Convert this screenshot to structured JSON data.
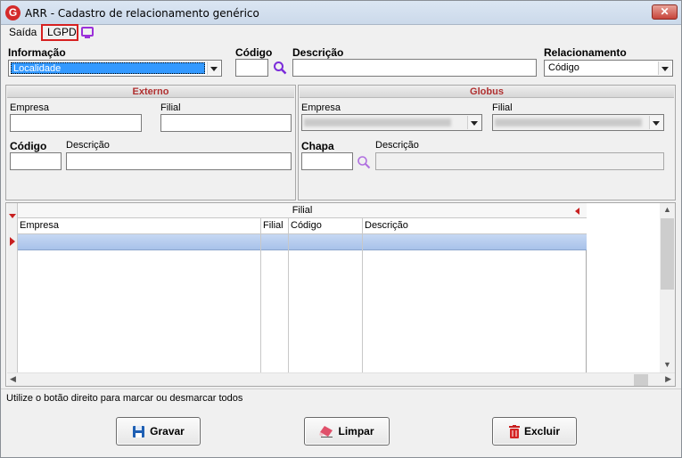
{
  "window": {
    "title": "ARR - Cadastro de relacionamento genérico",
    "close_label": "✕"
  },
  "menu": {
    "saida": "Saída",
    "lgpd": "LGPD"
  },
  "top": {
    "informacao_label": "Informação",
    "informacao_value": "Localidade",
    "codigo_label": "Código",
    "descricao_label": "Descrição",
    "relacionamento_label": "Relacionamento",
    "relacionamento_value": "Código"
  },
  "externo": {
    "title": "Externo",
    "empresa_label": "Empresa",
    "filial_label": "Filial",
    "codigo_label": "Código",
    "descricao_label": "Descrição"
  },
  "globus": {
    "title": "Globus",
    "empresa_label": "Empresa",
    "filial_label": "Filial",
    "chapa_label": "Chapa",
    "descricao_label": "Descrição"
  },
  "grid": {
    "group_label": "Filial",
    "columns": [
      "Empresa",
      "Filial",
      "Código",
      "Descrição"
    ]
  },
  "status": {
    "text": "Utilize o botão direito para marcar ou desmarcar todos"
  },
  "buttons": {
    "gravar": "Gravar",
    "limpar": "Limpar",
    "excluir": "Excluir"
  },
  "colors": {
    "accent": "#b03030",
    "selection": "#a8c2ea",
    "lgpd_highlight": "#d62020"
  }
}
